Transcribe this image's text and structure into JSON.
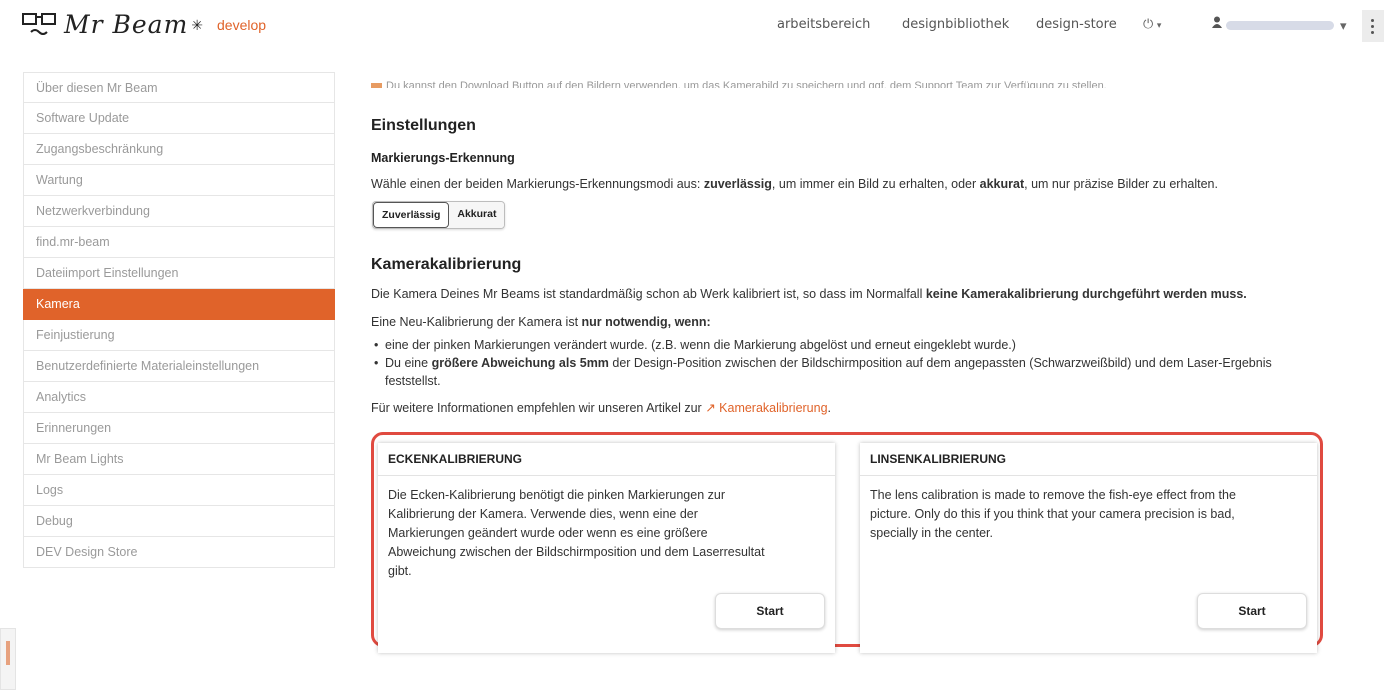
{
  "brand": {
    "name": "Mr Beam",
    "env_badge": "develop"
  },
  "nav": {
    "links": [
      "arbeitsbereich",
      "designbibliothek",
      "design-store"
    ],
    "power_caret": "▾",
    "user_caret": "▾"
  },
  "sidebar": {
    "items": [
      {
        "label": "Über diesen Mr Beam"
      },
      {
        "label": "Software Update"
      },
      {
        "label": "Zugangsbeschränkung"
      },
      {
        "label": "Wartung"
      },
      {
        "label": "Netzwerkverbindung"
      },
      {
        "label": "find.mr-beam"
      },
      {
        "label": "Dateiimport Einstellungen"
      },
      {
        "label": "Kamera",
        "active": true
      },
      {
        "label": "Feinjustierung"
      },
      {
        "label": "Benutzerdefinierte Materialeinstellungen"
      },
      {
        "label": "Analytics"
      },
      {
        "label": "Erinnerungen"
      },
      {
        "label": "Mr Beam Lights"
      },
      {
        "label": "Logs"
      },
      {
        "label": "Debug"
      },
      {
        "label": "DEV Design Store"
      }
    ]
  },
  "main": {
    "clipped_note": "Du kannst den Download Button auf den Bildern verwenden, um das Kamerabild zu speichern und ggf. dem Support Team zur Verfügung zu stellen.",
    "settings_title": "Einstellungen",
    "marker_title": "Markierungs-Erkennung",
    "marker_desc_1": "Wähle einen der beiden Markierungs-Erkennungsmodi aus: ",
    "marker_desc_b1": "zuverlässig",
    "marker_desc_2": ", um immer ein Bild zu erhalten, oder ",
    "marker_desc_b2": "akkurat",
    "marker_desc_3": ", um nur präzise Bilder zu erhalten.",
    "mode_reliable": "Zuverlässig",
    "mode_accurate": "Akkurat",
    "calib_title": "Kamerakalibrierung",
    "calib_p1_a": "Die Kamera Deines Mr Beams ist standardmäßig schon ab Werk kalibriert ist, so dass im Normalfall ",
    "calib_p1_b": "keine Kamerakalibrierung durchgeführt werden muss.",
    "calib_p2_a": "Eine Neu-Kalibrierung der Kamera ist ",
    "calib_p2_b": "nur notwendig, wenn:",
    "bullet1": "eine der pinken Markierungen verändert wurde. (z.B. wenn die Markierung abgelöst und erneut eingeklebt wurde.)",
    "bullet2_a": "Du eine ",
    "bullet2_b": "größere Abweichung als 5mm",
    "bullet2_c": " der Design-Position zwischen der Bildschirmposition auf dem angepassten (Schwarzweißbild) und dem Laser-Ergebnis",
    "bullet2_d": "feststellst.",
    "more_info": "Für weitere Informationen empfehlen wir unseren Artikel zur ",
    "more_info_link": "Kamerakalibrierung",
    "more_info_end": "."
  },
  "cards": {
    "corner": {
      "title": "ECKENKALIBRIERUNG",
      "l1": "Die Ecken-Kalibrierung benötigt die pinken Markierungen zur",
      "l2": "Kalibrierung der Kamera. Verwende dies, wenn eine der",
      "l3": "Markierungen geändert wurde oder wenn es eine größere",
      "l4": "Abweichung zwischen der Bildschirmposition und dem Laserresultat",
      "l5": "gibt.",
      "button": "Start"
    },
    "lens": {
      "title": "LINSENKALIBRIERUNG",
      "l1": "The lens calibration is made to remove the fish-eye effect from the",
      "l2": "picture. Only do this if you think that your camera precision is bad,",
      "l3": "specially in the center.",
      "button": "Start"
    }
  },
  "colors": {
    "accent": "#e0632a",
    "highlight_border": "#e04a40"
  }
}
